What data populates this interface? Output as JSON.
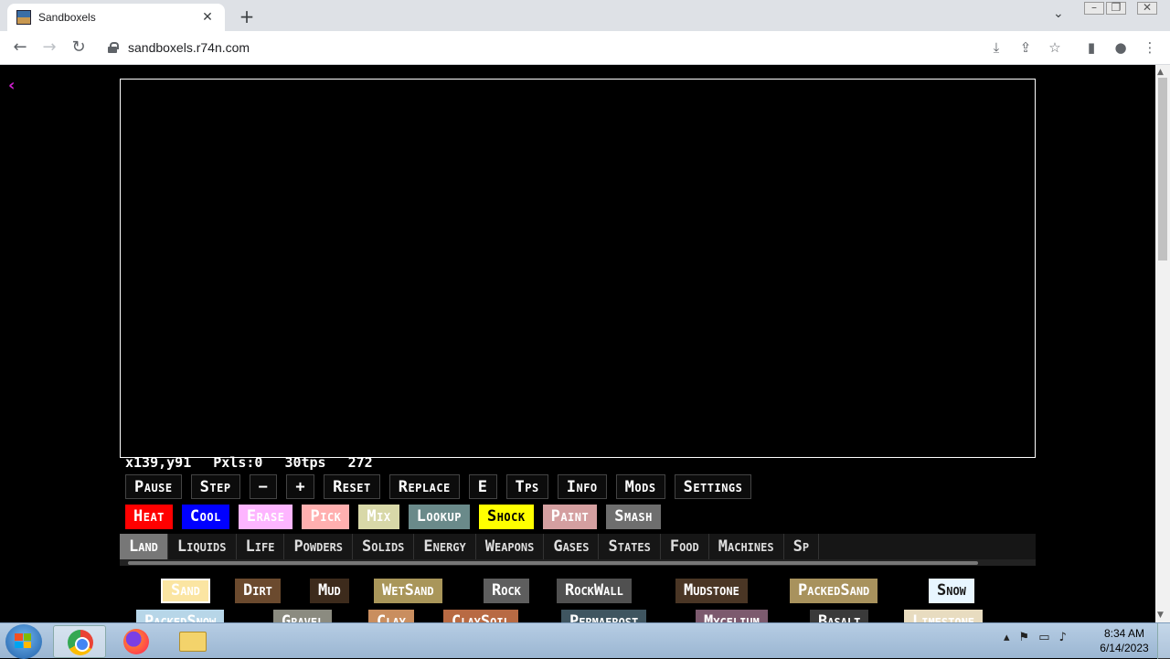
{
  "browser": {
    "tab_title": "Sandboxels",
    "url": "sandboxels.r74n.com"
  },
  "icons": {
    "back_nav": "←",
    "forward_nav": "→",
    "reload": "↻",
    "tab_close": "✕",
    "new_tab": "+",
    "tab_search_chevron": "⌄",
    "install": "⤓",
    "share": "⇪",
    "bookmark": "☆",
    "side_panel": "▮",
    "profile": "●",
    "menu": "⋮",
    "page_back": "‹"
  },
  "game": {
    "stats": {
      "coords": "x139,y91",
      "pixels": "Pxls:0",
      "tps": "30tps",
      "ticks": "272"
    },
    "controls": [
      "Pause",
      "Step",
      "−",
      "+",
      "Reset",
      "Replace",
      "E",
      "Tps",
      "Info",
      "Mods",
      "Settings"
    ],
    "tools": [
      {
        "label": "Heat",
        "bg": "#ff0000",
        "fg": "#ffffff"
      },
      {
        "label": "Cool",
        "bg": "#0000ff",
        "fg": "#ffffff"
      },
      {
        "label": "Erase",
        "bg": "#fdb5ff",
        "fg": "#ffffff"
      },
      {
        "label": "Pick",
        "bg": "#ffafaf",
        "fg": "#ffffff"
      },
      {
        "label": "Mix",
        "bg": "#d8d8a8",
        "fg": "#ffffff"
      },
      {
        "label": "Lookup",
        "bg": "#6a8a8a",
        "fg": "#ffffff"
      },
      {
        "label": "Shock",
        "bg": "#ffff00",
        "fg": "#000000"
      },
      {
        "label": "Paint",
        "bg": "#d49fa0",
        "fg": "#ffffff"
      },
      {
        "label": "Smash",
        "bg": "#6e6e6e",
        "fg": "#ffffff"
      }
    ],
    "categories": [
      {
        "label": "Land",
        "active": true
      },
      {
        "label": "Liquids",
        "active": false
      },
      {
        "label": "Life",
        "active": false
      },
      {
        "label": "Powders",
        "active": false
      },
      {
        "label": "Solids",
        "active": false
      },
      {
        "label": "Energy",
        "active": false
      },
      {
        "label": "Weapons",
        "active": false
      },
      {
        "label": "Gases",
        "active": false
      },
      {
        "label": "States",
        "active": false
      },
      {
        "label": "Food",
        "active": false
      },
      {
        "label": "Machines",
        "active": false
      },
      {
        "label": "Sp",
        "active": false
      }
    ],
    "elements_row1": [
      {
        "label": "Sand",
        "bg": "#fbe5a2",
        "fg": "#ffffff",
        "selected": true
      },
      {
        "label": "Dirt",
        "bg": "#6b4a2e",
        "fg": "#ffffff",
        "selected": false
      },
      {
        "label": "Mud",
        "bg": "#3d2b1c",
        "fg": "#ffffff",
        "selected": false
      },
      {
        "label": "WetSand",
        "bg": "#a9965a",
        "fg": "#ffffff",
        "selected": false
      },
      {
        "label": "Rock",
        "bg": "#5e5e5e",
        "fg": "#ffffff",
        "selected": false
      },
      {
        "label": "RockWall",
        "bg": "#505050",
        "fg": "#ffffff",
        "selected": false
      },
      {
        "label": "Mudstone",
        "bg": "#4a3625",
        "fg": "#ffffff",
        "selected": false
      },
      {
        "label": "PackedSand",
        "bg": "#a8925d",
        "fg": "#ffffff",
        "selected": false
      },
      {
        "label": "Snow",
        "bg": "#e8f6ff",
        "fg": "#1a1a1a",
        "selected": false
      }
    ],
    "elements_row2": [
      {
        "label": "PackedSnow",
        "bg": "#b7d6e8",
        "fg": "#ffffff"
      },
      {
        "label": "Gravel",
        "bg": "#8b8b80",
        "fg": "#ffffff"
      },
      {
        "label": "Clay",
        "bg": "#c98e5f",
        "fg": "#ffffff"
      },
      {
        "label": "ClaySoil",
        "bg": "#b86a43",
        "fg": "#ffffff"
      },
      {
        "label": "Permafrost",
        "bg": "#3f5560",
        "fg": "#ffffff"
      },
      {
        "label": "Mycelium",
        "bg": "#7c5a6e",
        "fg": "#ffffff"
      },
      {
        "label": "Basalt",
        "bg": "#3a3a3a",
        "fg": "#ffffff"
      },
      {
        "label": "Limestone",
        "bg": "#e8dcc0",
        "fg": "#ffffff"
      }
    ]
  },
  "taskbar": {
    "time": "8:34 AM",
    "date": "6/14/2023"
  }
}
